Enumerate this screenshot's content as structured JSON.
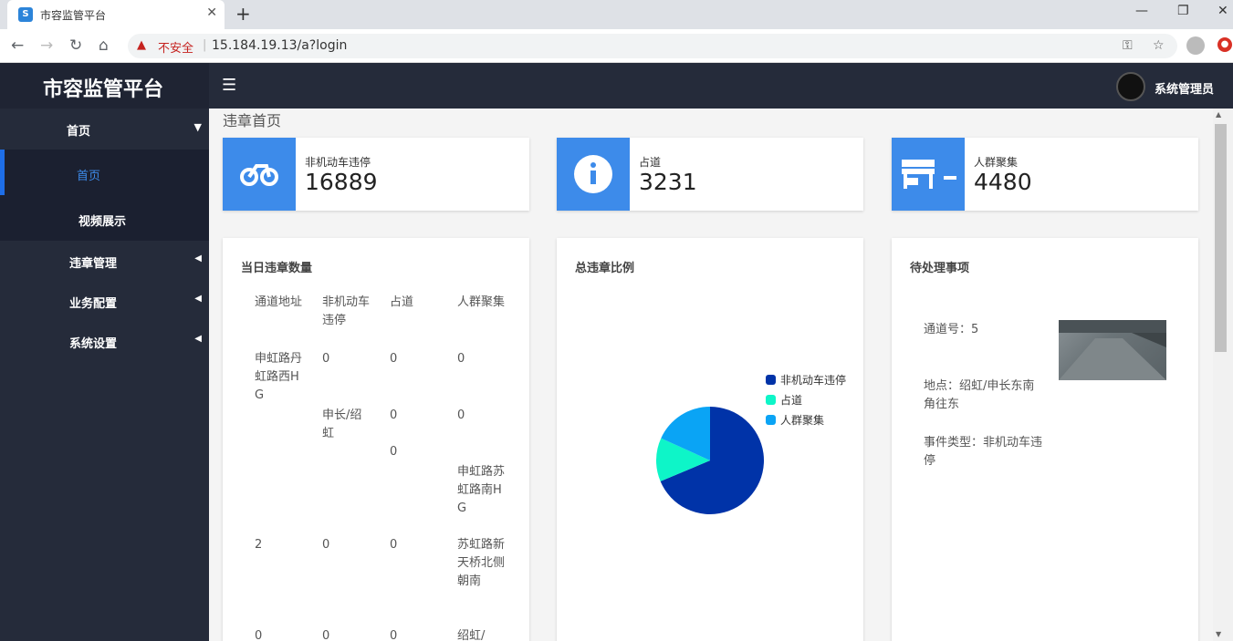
{
  "browser": {
    "tab_title": "市容监管平台",
    "url_warning": "不安全",
    "url": "15.184.19.13/a?login"
  },
  "header": {
    "logo": "市容监管平台",
    "user_name": "系统管理员"
  },
  "sidebar": {
    "items": [
      {
        "label": "首页"
      },
      {
        "label": "违章管理"
      },
      {
        "label": "业务配置"
      },
      {
        "label": "系统设置"
      }
    ],
    "sub_items": [
      {
        "label": "首页"
      },
      {
        "label": "视频展示"
      }
    ]
  },
  "page": {
    "title": "违章首页"
  },
  "stats": [
    {
      "label": "非机动车违停",
      "value": "16889",
      "icon": "bicycle-icon"
    },
    {
      "label": "占道",
      "value": "3231",
      "icon": "info-icon"
    },
    {
      "label": "人群聚集",
      "value": "4480",
      "icon": "store-icon"
    }
  ],
  "daily_table": {
    "title": "当日违章数量",
    "headers": [
      "通道地址",
      "非机动车违停",
      "占道",
      "人群聚集"
    ],
    "cells": {
      "r1_addr": "申虹路丹虹路西HG",
      "r1_c1": "0",
      "r1_c2": "0",
      "r1_c3": "0",
      "r2_c1": "申长/绍虹",
      "r2_c2": "0",
      "r2_c3": "0",
      "r3_c2": "0",
      "r4_c3": "申虹路苏虹路南HG",
      "r5_addr": "2",
      "r5_c1": "0",
      "r5_c2": "0",
      "r5_c3": "苏虹路新天桥北侧朝南",
      "r6_addr": "0",
      "r6_c1": "0",
      "r6_c2": "0",
      "r6_c3": "绍虹/"
    }
  },
  "ratio_panel": {
    "title": "总违章比例"
  },
  "chart_data": {
    "type": "pie",
    "categories": [
      "非机动车违停",
      "占道",
      "人群聚集"
    ],
    "values": [
      16889,
      3231,
      4480
    ],
    "colors": [
      "#0033a8",
      "#0ef5c8",
      "#0aa4f5"
    ],
    "legend": "right"
  },
  "pending": {
    "title": "待处理事项",
    "channel": "通道号：5",
    "location": "地点：绍虹/申长东南角往东",
    "event_type": "事件类型：非机动车违停"
  }
}
